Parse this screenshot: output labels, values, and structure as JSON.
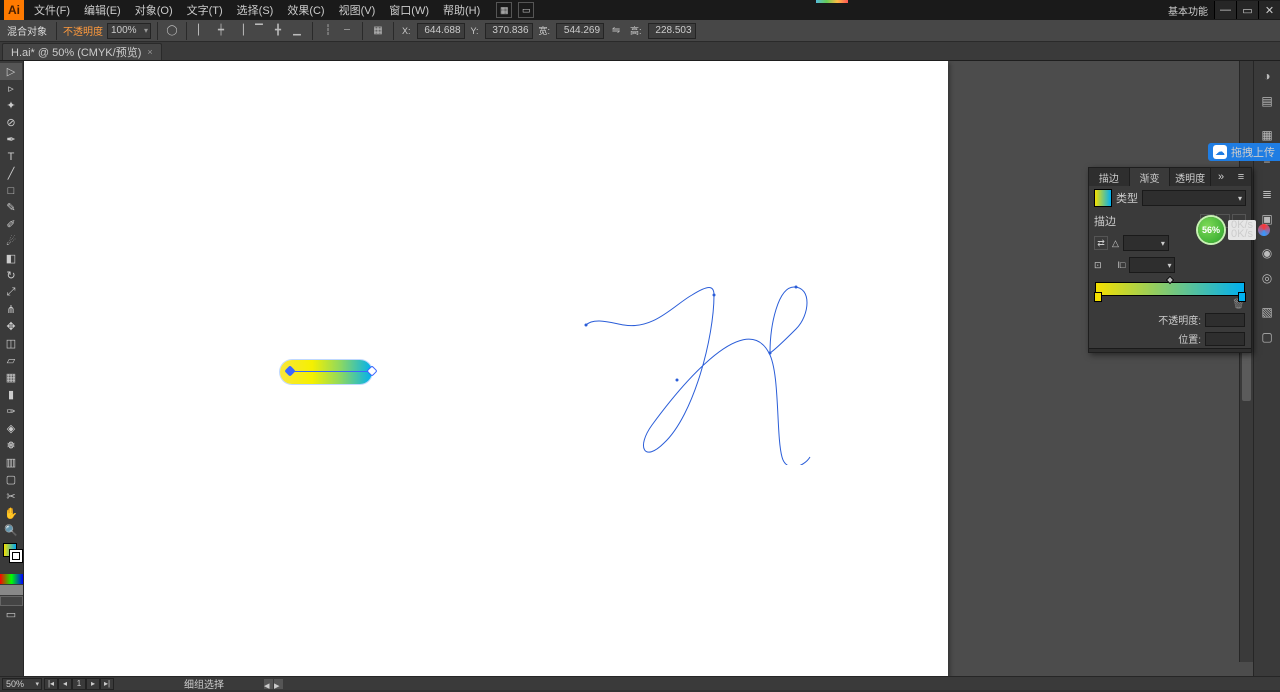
{
  "menu": {
    "file": "文件(F)",
    "edit": "编辑(E)",
    "object": "对象(O)",
    "type": "文字(T)",
    "select": "选择(S)",
    "effect": "效果(C)",
    "view": "视图(V)",
    "window": "窗口(W)",
    "help": "帮助(H)"
  },
  "workspace_label": "基本功能",
  "controlbar": {
    "blend_label": "混合对象",
    "opacity_label": "不透明度",
    "opacity_value": "100%",
    "x_label": "X:",
    "x_value": "644.688",
    "y_label": "Y:",
    "y_value": "370.836",
    "w_label": "宽:",
    "w_value": "544.269",
    "h_label": "高:",
    "h_value": "228.503"
  },
  "tab": {
    "name": "H.ai* @ 50% (CMYK/预览)"
  },
  "panel": {
    "tab_stroke": "描边",
    "tab_gradient": "渐变",
    "tab_transparency": "透明度",
    "type_label": "类型",
    "stroke_label": "描边",
    "opacity_label": "不透明度:",
    "location_label": "位置:"
  },
  "bluetag": "拖拽上传",
  "net_percent": "56%",
  "net_speed_up": "0K/s",
  "net_speed_down": "0K/s",
  "statusbar": {
    "zoom": "50%",
    "nav_page": "1",
    "mode": "细组选择"
  },
  "chart_data": null
}
